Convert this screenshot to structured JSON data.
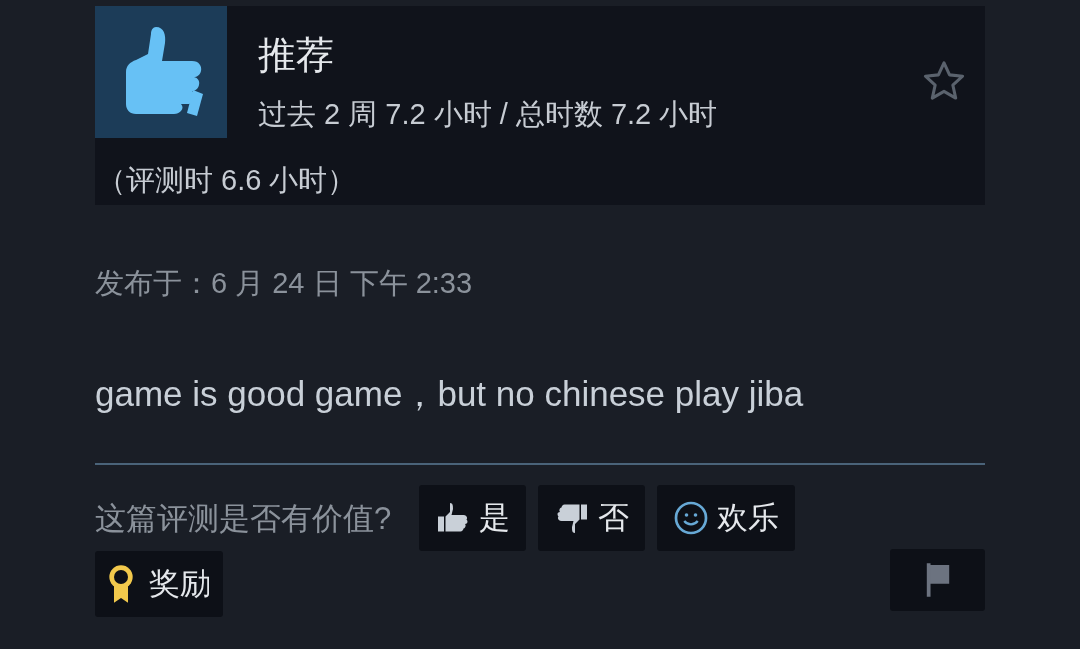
{
  "review": {
    "verdict": "推荐",
    "hours": "过去 2 周 7.2 小时 / 总时数 7.2 小时",
    "hours_at_review": "（评测时 6.6 小时）",
    "posted": "发布于：6 月 24 日 下午 2:33",
    "body": "game is good game，but no chinese play jiba"
  },
  "helpful": {
    "question": "这篇评测是否有价值?",
    "buttons": [
      {
        "kind": "yes",
        "label": "是"
      },
      {
        "kind": "no",
        "label": "否"
      },
      {
        "kind": "funny",
        "label": "欢乐"
      }
    ]
  },
  "award": {
    "label": "奖励"
  }
}
